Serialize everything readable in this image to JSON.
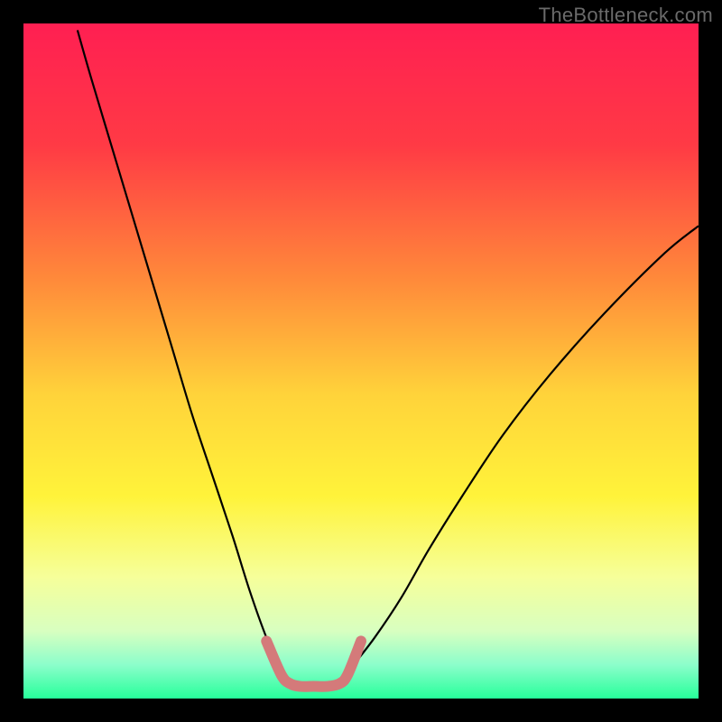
{
  "watermark": "TheBottleneck.com",
  "chart_data": {
    "type": "line",
    "title": "",
    "xlabel": "",
    "ylabel": "",
    "xlim": [
      0,
      100
    ],
    "ylim": [
      0,
      100
    ],
    "gradient_stops": [
      {
        "offset": 0,
        "color": "#ff1f52"
      },
      {
        "offset": 18,
        "color": "#ff3a45"
      },
      {
        "offset": 38,
        "color": "#ff8a3a"
      },
      {
        "offset": 55,
        "color": "#ffd33a"
      },
      {
        "offset": 70,
        "color": "#fff33a"
      },
      {
        "offset": 82,
        "color": "#f6ff9a"
      },
      {
        "offset": 90,
        "color": "#d8ffc0"
      },
      {
        "offset": 95,
        "color": "#8cfecb"
      },
      {
        "offset": 100,
        "color": "#26ff9a"
      }
    ],
    "series": [
      {
        "name": "bottleneck-curve-left",
        "stroke": "#000000",
        "stroke_width": 2.2,
        "x": [
          8.0,
          10.0,
          13.0,
          16.0,
          19.0,
          22.0,
          25.0,
          28.0,
          31.0,
          33.5,
          36.0,
          38.0
        ],
        "y": [
          99.0,
          92.0,
          82.0,
          72.0,
          62.0,
          52.0,
          42.0,
          33.0,
          24.0,
          16.0,
          9.0,
          4.5
        ]
      },
      {
        "name": "bottleneck-curve-right",
        "stroke": "#000000",
        "stroke_width": 2.2,
        "x": [
          48.5,
          52.0,
          56.0,
          60.0,
          65.0,
          71.0,
          78.0,
          86.0,
          95.0,
          100.0
        ],
        "y": [
          4.5,
          9.0,
          15.0,
          22.0,
          30.0,
          39.0,
          48.0,
          57.0,
          66.0,
          70.0
        ]
      },
      {
        "name": "optimal-range-marker",
        "stroke": "#d47a7a",
        "stroke_width": 12,
        "linecap": "round",
        "x": [
          36.0,
          38.2,
          39.5,
          41.0,
          43.0,
          45.0,
          46.8,
          48.0,
          50.0
        ],
        "y": [
          8.5,
          3.5,
          2.2,
          1.8,
          1.8,
          1.8,
          2.2,
          3.5,
          8.5
        ]
      }
    ]
  }
}
